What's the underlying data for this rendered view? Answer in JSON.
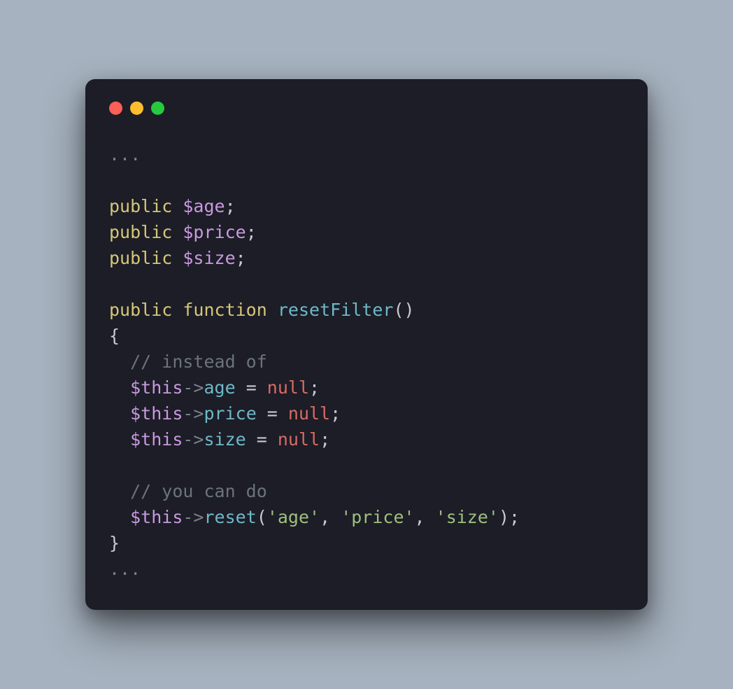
{
  "trafficLights": {
    "red": "close-icon",
    "yellow": "minimize-icon",
    "green": "maximize-icon"
  },
  "code": {
    "ellipsisTop": "...",
    "kwPublic": "public",
    "kwFunction": "function",
    "varAge": "$age",
    "varPrice": "$price",
    "varSize": "$size",
    "fnName": "resetFilter",
    "parens": "()",
    "braceOpen": "{",
    "braceClose": "}",
    "commentInstead": "// instead of",
    "commentYouCan": "// you can do",
    "thisVar": "$this",
    "arrow": "->",
    "propAge": "age",
    "propPrice": "price",
    "propSize": "size",
    "eq": " = ",
    "nullKw": "null",
    "semi": ";",
    "resetCall": "reset",
    "openP": "(",
    "closeP": ")",
    "strAge": "'age'",
    "strPrice": "'price'",
    "strSize": "'size'",
    "comma": ", ",
    "ellipsisBottom": "...",
    "indent": "  "
  }
}
